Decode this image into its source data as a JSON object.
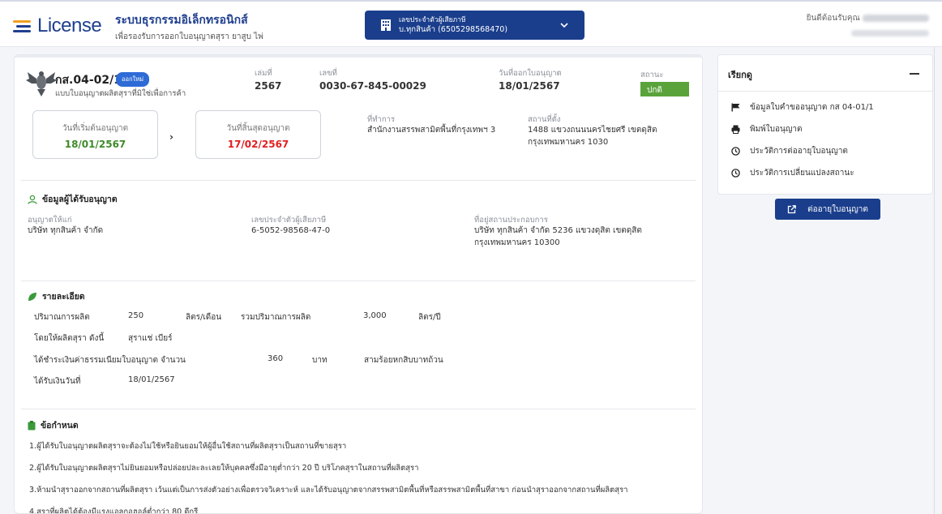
{
  "header": {
    "logo_text": "License",
    "system_title": "ระบบธุรกรรมอิเล็กทรอนิกส์",
    "system_subtitle": "เพื่อรองรับการออกใบอนุญาตสุรา ยาสูบ ไพ่",
    "tax_id_label": "เลขประจำตัวผู้เสียภาษี",
    "tax_id_value": "บ.ทุกสินค้า (6505298568470)",
    "welcome_text": "ยินดีต้อนรับคุณ"
  },
  "license": {
    "code": "กส.04-02/1",
    "badge": "ออกใหม่",
    "type": "แบบใบอนุญาตผลิตสุราที่มิใช่เพื่อการค้า",
    "book_no_label": "เล่มที่",
    "book_no": "2567",
    "no_label": "เลขที่",
    "no": "0030-67-845-00029",
    "issue_date_label": "วันที่ออกใบอนุญาต",
    "issue_date": "18/01/2567",
    "status_label": "สถานะ",
    "status": "ปกติ",
    "start_label": "วันที่เริ่มต้นอนุญาต",
    "start_date": "18/01/2567",
    "end_label": "วันที่สิ้นสุดอนุญาต",
    "end_date": "17/02/2567",
    "office_label": "ที่ทำการ",
    "office": "สำนักงานสรรพสามิตพื้นที่กรุงเทพฯ 3",
    "location_label": "สถานที่ตั้ง",
    "location_line1": "1488 แขวงถนนนครไชยศรี เขตดุสิต",
    "location_line2": "กรุงเทพมหานคร 1030"
  },
  "licensee": {
    "section_title": "ข้อมูลผู้ได้รับอนุญาต",
    "grantee_label": "อนุญาตให้แก่",
    "grantee": "บริษัท ทุกสินค้า จำกัด",
    "taxid_label": "เลขประจำตัวผู้เสียภาษี",
    "taxid": "6-5052-98568-47-0",
    "address_label": "ที่อยู่สถานประกอบการ",
    "address_line1": "บริษัท ทุกสินค้า จำกัด 5236 แขวงดุสิต เขตดุสิต",
    "address_line2": "กรุงเทพมหานคร 10300"
  },
  "details": {
    "section_title": "รายละเอียด",
    "production_label": "ปริมาณการผลิต",
    "production_value": "250",
    "production_unit": "ลิตร/เดือน",
    "total_label": "รวมปริมาณการผลิต",
    "total_value": "3,000",
    "total_unit": "ลิตร/ปี",
    "liquor_label": "โดยให้ผลิตสุรา ดังนี้",
    "liquor_value": "สุราแช่ เบียร์",
    "fee_label": "ได้ชำระเงินค่าธรรมเนียมใบอนุญาต จำนวน",
    "fee_value": "360",
    "fee_unit": "บาท",
    "fee_text": "สามร้อยหกสิบบาทถ้วน",
    "paid_date_label": "ได้รับเงินวันที่",
    "paid_date": "18/01/2567"
  },
  "conditions": {
    "section_title": "ข้อกำหนด",
    "items": [
      "1.ผู้ได้รับใบอนุญาตผลิตสุราจะต้องไม่ใช้หรือยินยอมให้ผู้อื่นใช้สถานที่ผลิตสุราเป็นสถานที่ขายสุรา",
      "2.ผู้ได้รับใบอนุญาตผลิตสุราไม่ยินยอมหรือปล่อยปละละเลยให้บุคคลซึ่งมีอายุต่ำกว่า 20 ปี บริโภคสุราในสถานที่ผลิตสุรา",
      "3.ห้ามนำสุราออกจากสถานที่ผลิตสุรา เว้นแต่เป็นการส่งตัวอย่างเพื่อตรวจวิเคราะห์ และได้รับอนุญาตจากสรรพสามิตพื้นที่หรือสรรพสามิตพื้นที่สาขา ก่อนนำสุราออกจากสถานที่ผลิตสุรา",
      "4.สุราที่ผลิตได้ต้องมีแรงแอลกอฮอล์ต่ำกว่า 80 ดีกรี"
    ]
  },
  "sidebar": {
    "title": "เรียกดู",
    "items": [
      "ข้อมูลใบคำขออนุญาต กส 04-01/1",
      "พิมพ์ใบอนุญาต",
      "ประวัติการต่ออายุใบอนุญาต",
      "ประวัติการเปลี่ยนแปลงสถานะ"
    ],
    "renew_button": "ต่ออายุใบอนุญาต"
  },
  "colors": {
    "primary": "#1a3e8c",
    "status_green": "#5aa33a",
    "start_date_green": "#3e8a2a",
    "end_date_red": "#e02020",
    "badge_blue": "#2f6bd6"
  }
}
